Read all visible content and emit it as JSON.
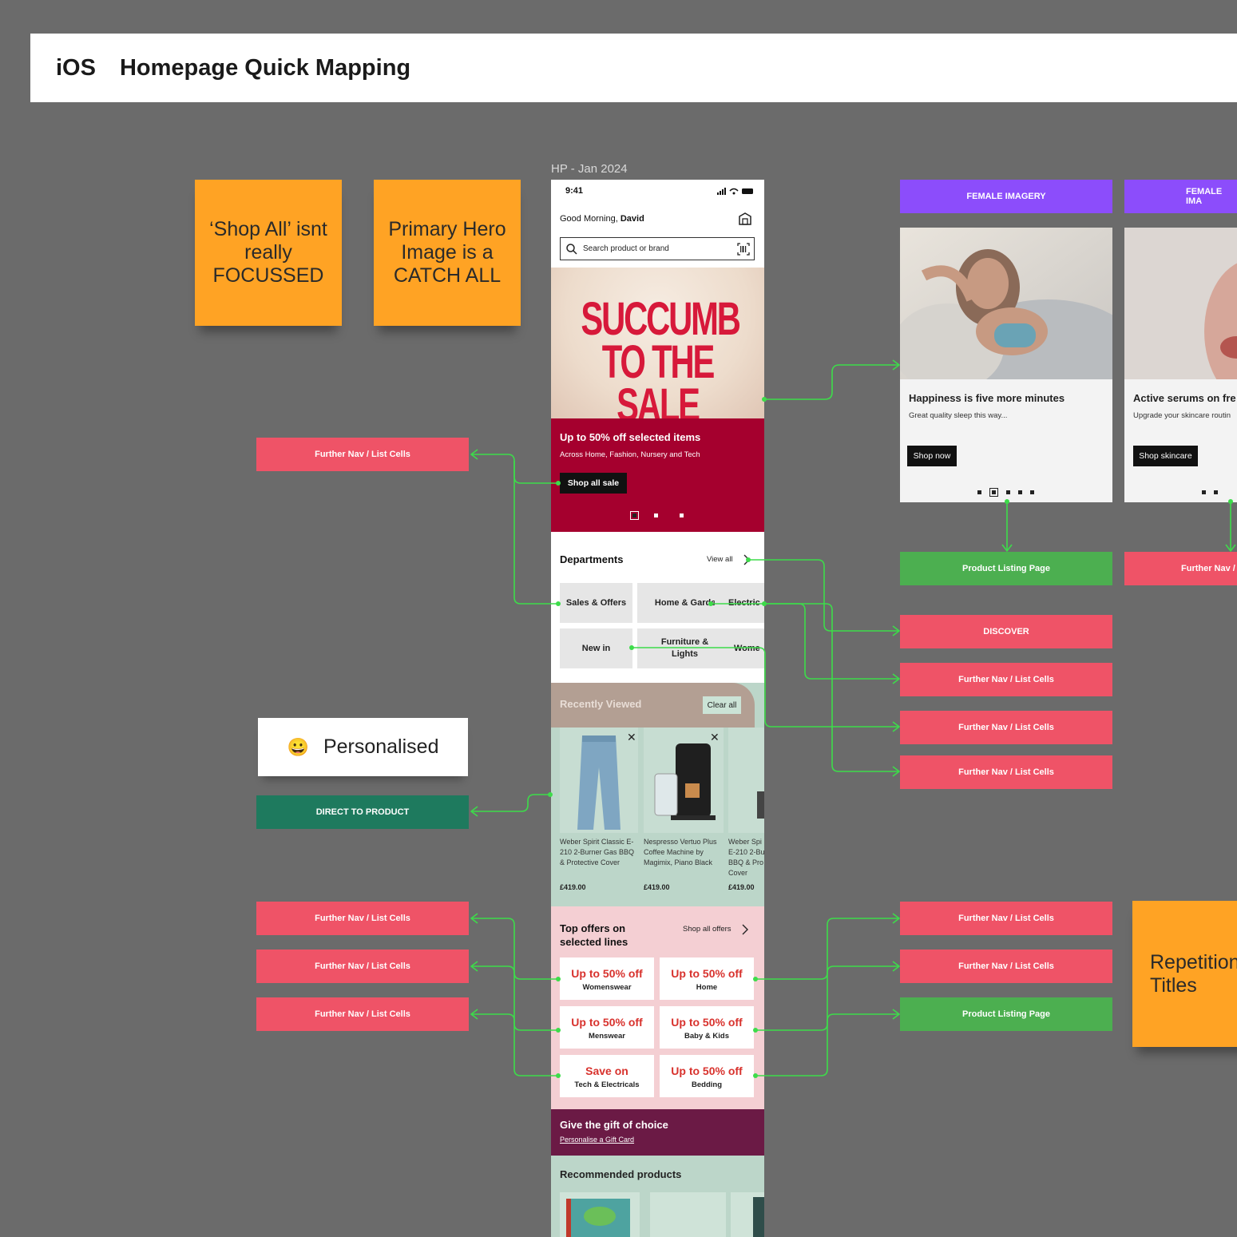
{
  "header": {
    "platform": "iOS",
    "title": "Homepage Quick Mapping"
  },
  "notes": {
    "shop_all": "‘Shop All’ isnt really FOCUSSED",
    "primary_hero": "Primary Hero Image is a CATCH ALL",
    "repetition": "Repetition Titles",
    "personalised_emoji": "😀",
    "personalised": "Personalised"
  },
  "frame_label": "HP - Jan 2024",
  "phone": {
    "time": "9:41",
    "greeting_prefix": "Good Morning, ",
    "greeting_name": "David",
    "search_placeholder": "Search product or brand",
    "hero": {
      "line1": "SUCCUMB",
      "line2": "TO THE SALE",
      "headline": "Up to 50% off selected items",
      "sub": "Across Home, Fashion, Nursery and Tech",
      "cta": "Shop all sale"
    },
    "departments": {
      "title": "Departments",
      "view_all": "View all",
      "tiles": [
        "Sales & Offers",
        "Home & Garden",
        "Electric",
        "New in",
        "Furniture & Lights",
        "Wome"
      ]
    },
    "recently_viewed": {
      "title": "Recently Viewed",
      "clear": "Clear all",
      "items": [
        {
          "name": "Weber Spirit Classic E-210 2-Burner Gas BBQ & Protective Cover",
          "price": "£419.00"
        },
        {
          "name": "Nespresso Vertuo Plus Coffee Machine by Magimix, Piano Black",
          "price": "£419.00"
        },
        {
          "name": "Weber Spi E-210 2-Bur BBQ & Pro Cover",
          "price": "£419.00"
        }
      ]
    },
    "top_offers": {
      "title": "Top offers on selected lines",
      "link": "Shop all offers",
      "tiles": [
        {
          "headline": "Up to 50% off",
          "sub": "Womenswear"
        },
        {
          "headline": "Up to 50% off",
          "sub": "Home"
        },
        {
          "headline": "Up to 50% off",
          "sub": "Menswear"
        },
        {
          "headline": "Up to 50% off",
          "sub": "Baby & Kids"
        },
        {
          "headline": "Save on",
          "sub": "Tech & Electricals"
        },
        {
          "headline": "Up to 50% off",
          "sub": "Bedding"
        }
      ]
    },
    "gift": {
      "title": "Give the gift of choice",
      "link": "Personalise a Gift Card"
    },
    "recommended": {
      "title": "Recommended products"
    }
  },
  "cards": [
    {
      "tag": "FEMALE IMAGERY",
      "title": "Happiness is five more minutes",
      "sub": "Great quality sleep this way...",
      "cta": "Shop now"
    },
    {
      "tag": "FEMALE IMA",
      "title": "Active serums on fre",
      "sub": "Upgrade your skincare routin",
      "cta": "Shop skincare"
    }
  ],
  "tags": {
    "further_nav": "Further Nav / List Cells",
    "further_nav_short": "Further Nav /",
    "plp": "Product Listing Page",
    "discover": "DISCOVER",
    "direct": "DIRECT TO PRODUCT"
  },
  "colors": {
    "background": "#6b6b6b",
    "sticky": "#ffa324",
    "nav_red": "#ef5367",
    "plp_green": "#4caf50",
    "imagery_purple": "#8c4dfb",
    "direct_teal": "#1e7a5e",
    "link_line": "#3ddc4a",
    "hero_crimson": "#a5002e"
  }
}
